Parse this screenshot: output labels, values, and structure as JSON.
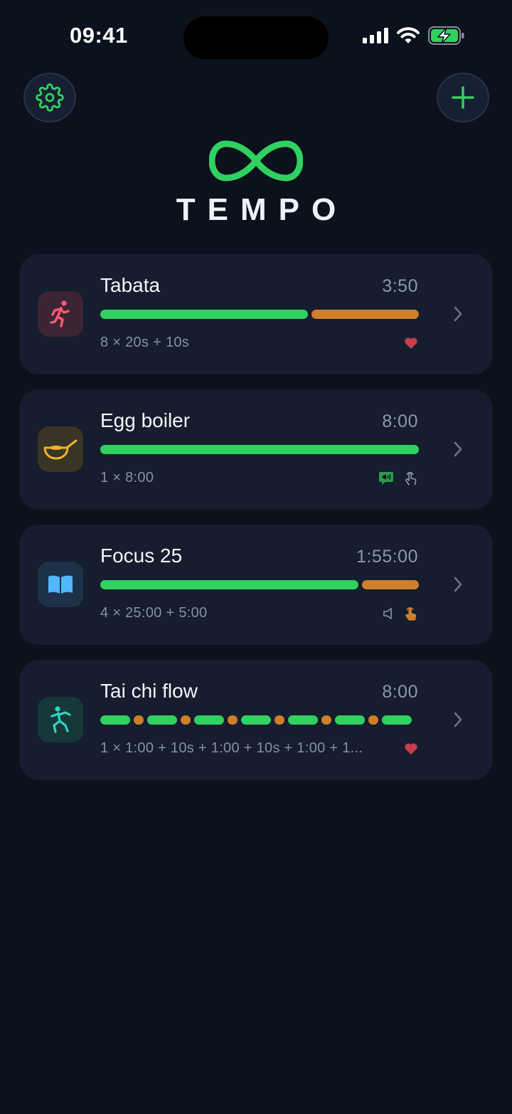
{
  "status": {
    "time": "09:41"
  },
  "brand": {
    "title": "TEMPO",
    "accent": "#31d160"
  },
  "colors": {
    "work": "#31d160",
    "rest": "#cf7f2c",
    "favorite": "#c83e4d"
  },
  "timers": [
    {
      "name": "Tabata",
      "total": "3:50",
      "summary": "8 × 20s + 10s",
      "icon": "running-person-icon"
    },
    {
      "name": "Egg boiler",
      "total": "8:00",
      "summary": "1 × 8:00",
      "icon": "frying-pan-icon"
    },
    {
      "name": "Focus 25",
      "total": "1:55:00",
      "summary": "4 × 25:00 + 5:00",
      "icon": "open-book-icon"
    },
    {
      "name": "Tai chi flow",
      "total": "8:00",
      "summary": "1 × 1:00 + 10s + 1:00 + 10s + 1:00 + 1...",
      "icon": "tai-chi-figure-icon"
    }
  ]
}
